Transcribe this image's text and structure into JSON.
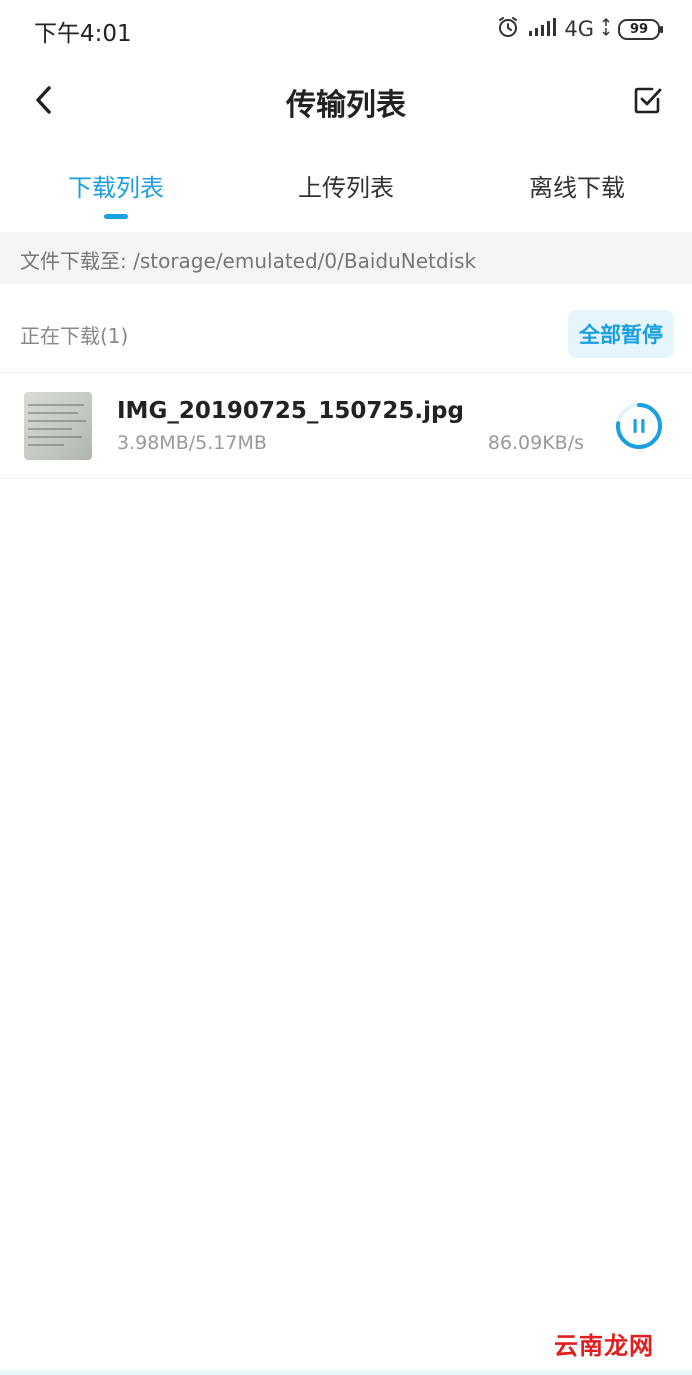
{
  "status_bar": {
    "time": "下午4:01",
    "network": "4G",
    "battery": "99"
  },
  "header": {
    "title": "传输列表"
  },
  "tabs": [
    {
      "label": "下载列表",
      "active": true
    },
    {
      "label": "上传列表",
      "active": false
    },
    {
      "label": "离线下载",
      "active": false
    }
  ],
  "download_path": "文件下载至: /storage/emulated/0/BaiduNetdisk",
  "section": {
    "title": "正在下载(1)",
    "pause_all_label": "全部暂停"
  },
  "downloads": [
    {
      "file_name": "IMG_20190725_150725.jpg",
      "size_progress": "3.98MB/5.17MB",
      "speed": "86.09KB/s",
      "progress_fraction": 0.77
    }
  ],
  "watermark": "云南龙网",
  "colors": {
    "accent": "#1a9fe0",
    "text_primary": "#222222",
    "text_secondary": "#999999",
    "path_bar_bg": "#f5f5f5",
    "pause_all_bg": "#e6f5fc"
  },
  "icons": {
    "back": "chevron-left-icon",
    "select": "checkbox-select-icon",
    "alarm": "alarm-icon",
    "signal": "signal-icon",
    "battery": "battery-icon",
    "pause": "pause-icon"
  }
}
